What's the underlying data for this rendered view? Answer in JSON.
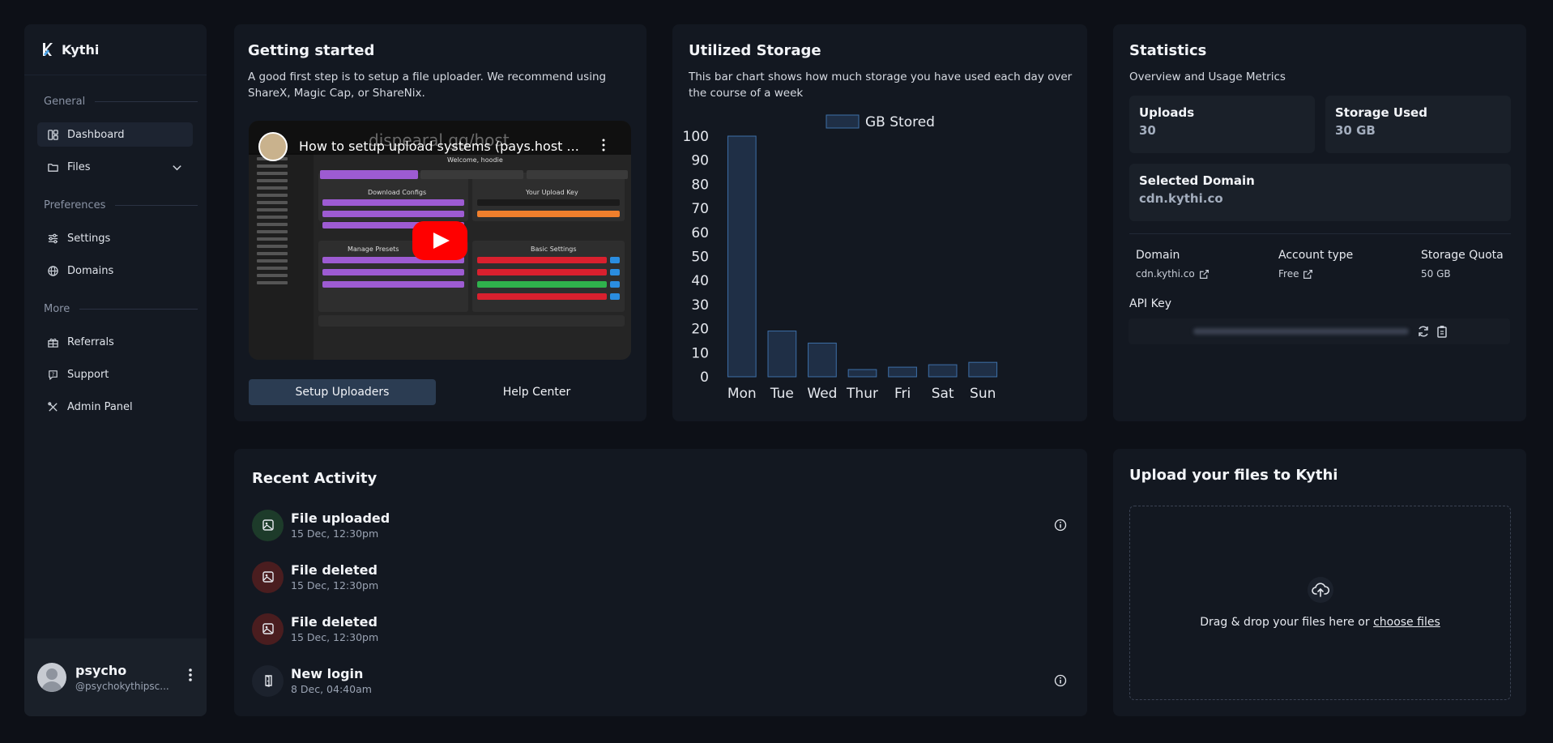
{
  "brand": {
    "name": "Kythi"
  },
  "sidebar": {
    "sections": {
      "general": "General",
      "preferences": "Preferences",
      "more": "More"
    },
    "items": [
      {
        "label": "Dashboard",
        "icon": "dashboard-icon"
      },
      {
        "label": "Files",
        "icon": "folder-icon"
      },
      {
        "label": "Settings",
        "icon": "sliders-icon"
      },
      {
        "label": "Domains",
        "icon": "globe-icon"
      },
      {
        "label": "Referrals",
        "icon": "gift-icon"
      },
      {
        "label": "Support",
        "icon": "help-icon"
      },
      {
        "label": "Admin Panel",
        "icon": "tools-icon"
      }
    ],
    "user": {
      "name": "psycho",
      "handle": "@psychokythipsc..."
    }
  },
  "getting_started": {
    "title": "Getting started",
    "description": "A good first step is to setup a file uploader. We recommend using ShareX, Magic Cap, or ShareNix.",
    "video": {
      "title": "How to setup upload systems (pays.host ...",
      "overlay": "dispearal.gg/host",
      "welcome": "Welcome, hoodie",
      "sections": [
        "Download Configs",
        "Your Upload Key",
        "Manage Presets",
        "Basic Settings"
      ]
    },
    "setup_button": "Setup Uploaders",
    "help_link": "Help Center"
  },
  "storage": {
    "title": "Utilized Storage",
    "description": "This bar chart shows how much storage you have used each day over the course of a week"
  },
  "chart_data": {
    "type": "bar",
    "categories": [
      "Mon",
      "Tue",
      "Wed",
      "Thur",
      "Fri",
      "Sat",
      "Sun"
    ],
    "series": [
      {
        "name": "GB Stored",
        "values": [
          100,
          19,
          14,
          3,
          4,
          5,
          6
        ]
      }
    ],
    "ylim": [
      0,
      100
    ],
    "yticks": [
      0,
      10,
      20,
      30,
      40,
      50,
      60,
      70,
      80,
      90,
      100
    ],
    "legend": "top-center",
    "colors": {
      "fill": "#1f2f46",
      "stroke": "#3d6fa8"
    }
  },
  "statistics": {
    "title": "Statistics",
    "subtitle": "Overview and Usage Metrics",
    "uploads_label": "Uploads",
    "uploads_value": "30",
    "storage_label": "Storage Used",
    "storage_value": "30 GB",
    "domain_label": "Selected Domain",
    "domain_value": "cdn.kythi.co",
    "details": {
      "domain_label": "Domain",
      "domain_value": "cdn.kythi.co",
      "account_label": "Account type",
      "account_value": "Free",
      "quota_label": "Storage Quota",
      "quota_value": "50 GB"
    },
    "api_key_label": "API Key"
  },
  "recent_activity": {
    "title": "Recent Activity",
    "items": [
      {
        "title": "File uploaded",
        "time": "15 Dec, 12:30pm",
        "color": "#1d3b2a"
      },
      {
        "title": "File deleted",
        "time": "15 Dec, 12:30pm",
        "color": "#4a1d1f"
      },
      {
        "title": "File deleted",
        "time": "15 Dec, 12:30pm",
        "color": "#4a1d1f"
      },
      {
        "title": "New login",
        "time": "8 Dec, 04:40am",
        "color": "#1c222d"
      }
    ]
  },
  "upload": {
    "title": "Upload your files to Kythi",
    "drop_text": "Drag & drop your files here or ",
    "choose_link": "choose files"
  }
}
